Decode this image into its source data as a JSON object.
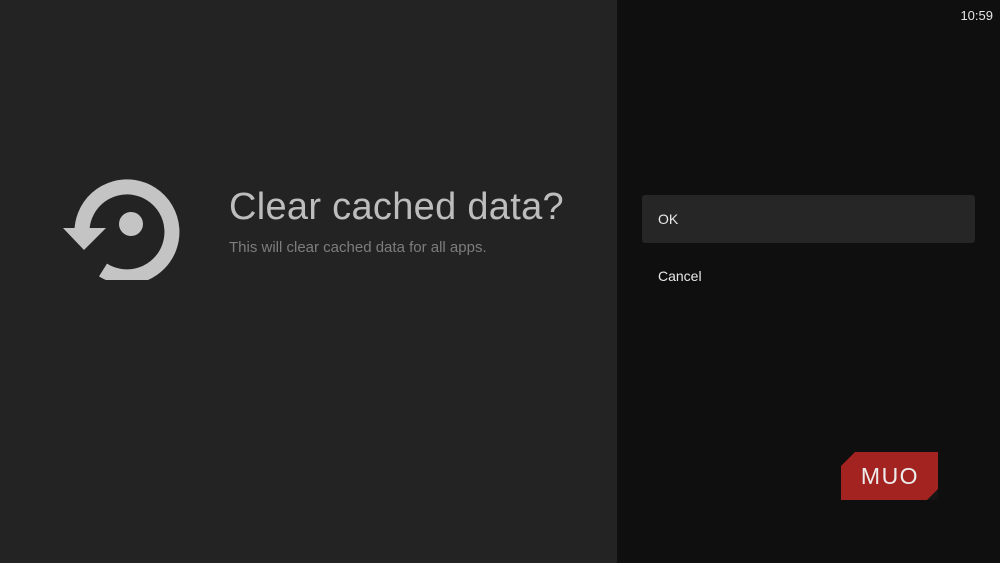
{
  "status_bar": {
    "time": "10:59"
  },
  "dialog": {
    "icon": "restore-icon",
    "title": "Clear cached data?",
    "description": "This will clear cached data for all apps."
  },
  "actions": [
    {
      "label": "OK",
      "focused": true
    },
    {
      "label": "Cancel",
      "focused": false
    }
  ],
  "watermark": {
    "text": "MUO",
    "color": "#a32320"
  },
  "colors": {
    "left_background": "#232323",
    "right_background": "#0f0f0f",
    "focused_item": "#262626"
  }
}
